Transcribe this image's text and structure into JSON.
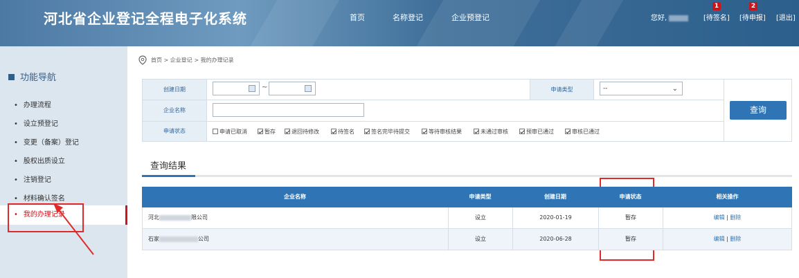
{
  "header": {
    "title": "河北省企业登记全程电子化系统",
    "nav": [
      "首页",
      "名称登记",
      "企业预登记"
    ],
    "greeting": "您好,",
    "links": [
      {
        "label": "[待签名]",
        "badge": "1"
      },
      {
        "label": "[待申报]",
        "badge": "2"
      },
      {
        "label": "[退出]"
      }
    ]
  },
  "sidebar": {
    "title": "功能导航",
    "items": [
      {
        "label": "办理流程"
      },
      {
        "label": "设立预登记"
      },
      {
        "label": "变更（备案）登记"
      },
      {
        "label": "股权出质设立"
      },
      {
        "label": "注销登记"
      },
      {
        "label": "材料确认签名"
      },
      {
        "label": "我的办理记录"
      }
    ],
    "bullet": "•"
  },
  "breadcrumb": "首页 > 企业登记 > 我的办理记录",
  "form": {
    "create_date_label": "创建日期",
    "date_separator": "~",
    "apply_type_label": "申请类型",
    "apply_type_value": "--",
    "company_name_label": "企业名称",
    "apply_status_label": "申请状态",
    "status_options": [
      {
        "label": "申请已取消",
        "checked": false
      },
      {
        "label": "暂存",
        "checked": true
      },
      {
        "label": "退回待修改",
        "checked": true
      },
      {
        "label": "待签名",
        "checked": true
      },
      {
        "label": "签名完毕待提交",
        "checked": true
      },
      {
        "label": "等待审核结果",
        "checked": true
      },
      {
        "label": "未通过审核",
        "checked": true
      },
      {
        "label": "预审已通过",
        "checked": true
      },
      {
        "label": "审核已通过",
        "checked": true
      }
    ],
    "query_button": "查询"
  },
  "results": {
    "title": "查询结果",
    "columns": [
      "企业名称",
      "申请类型",
      "创建日期",
      "申请状态",
      "相关操作"
    ],
    "rows": [
      {
        "name_prefix": "河北",
        "name_suffix": "限公司",
        "type": "设立",
        "date": "2020-01-19",
        "status": "暂存",
        "edit": "编辑",
        "sep": "|",
        "del": "删除"
      },
      {
        "name_prefix": "石家",
        "name_suffix": "公司",
        "type": "设立",
        "date": "2020-06-28",
        "status": "暂存",
        "edit": "编辑",
        "sep": "|",
        "del": "删除"
      }
    ]
  },
  "colors": {
    "header": "#3f6f99",
    "accent": "#2f75b5",
    "annotation": "#e02a2a",
    "active": "#c8161d"
  }
}
